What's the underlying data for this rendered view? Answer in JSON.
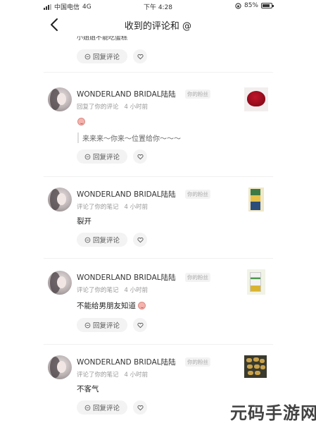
{
  "status_bar": {
    "carrier": "中国电信",
    "network": "4G",
    "time": "下午 4:28",
    "battery": "85%",
    "battery_level": 0.85
  },
  "nav": {
    "title": "收到的评论和 @"
  },
  "previous": {
    "partial_text": "小姐姐不能吃蛋糕",
    "reply_label": "回复评论"
  },
  "items": [
    {
      "username": "WONDERLAND BRIDAL陆陆",
      "badge": "你的粉丝",
      "action": "回复了你的评论",
      "time": "4 小时前",
      "content": "",
      "quote": "来来来～你来～位置给你～～～",
      "reply_label": "回复评论",
      "thumb": "rose-photo"
    },
    {
      "username": "WONDERLAND BRIDAL陆陆",
      "badge": "你的粉丝",
      "action": "评论了你的笔记",
      "time": "4 小时前",
      "content": "裂开",
      "reply_label": "回复评论",
      "thumb": "book-photo"
    },
    {
      "username": "WONDERLAND BRIDAL陆陆",
      "badge": "你的粉丝",
      "action": "评论了你的笔记",
      "time": "4 小时前",
      "content": "不能给男朋友知道",
      "reply_label": "回复评论",
      "thumb": "book-photo-2"
    },
    {
      "username": "WONDERLAND BRIDAL陆陆",
      "badge": "你的粉丝",
      "action": "评论了你的笔记",
      "time": "4 小时前",
      "content": "不客气",
      "reply_label": "回复评论",
      "thumb": "food-photo"
    }
  ],
  "watermark": "元码手游网",
  "icons": {
    "back": "chevron-left-icon",
    "reply": "comment-bubble-icon",
    "like": "heart-icon",
    "emoji": "pig-face-emoji"
  },
  "colors": {
    "background": "#ffffff",
    "button_bg": "#f3f3f3",
    "meta_text": "#999999"
  }
}
